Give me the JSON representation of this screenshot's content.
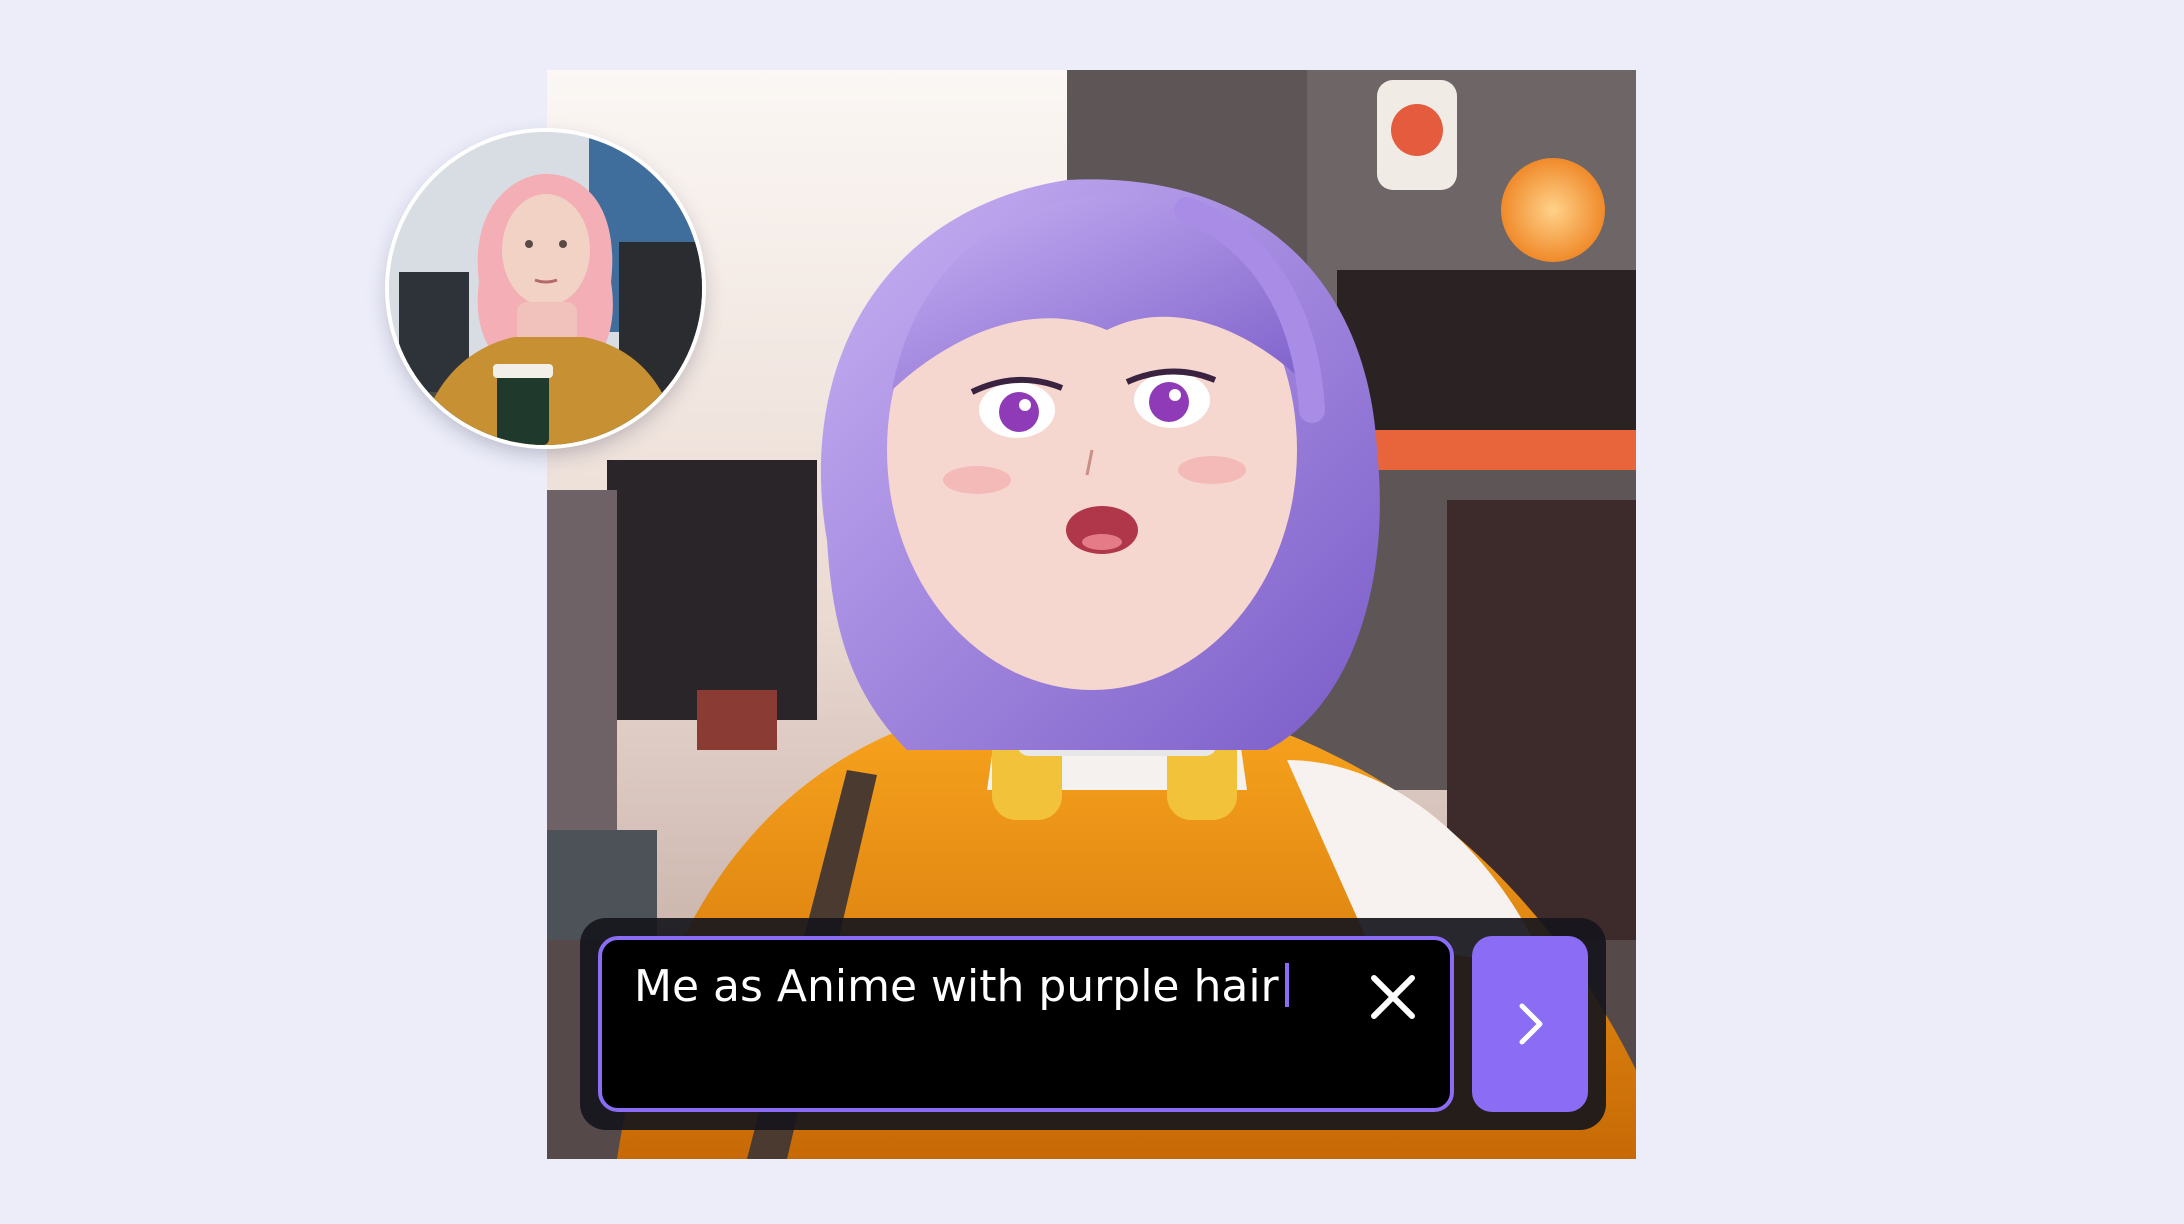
{
  "prompt": {
    "value": "Me as Anime with purple hair"
  },
  "icons": {
    "clear": "close-icon",
    "submit": "chevron-right-icon"
  },
  "colors": {
    "page_background": "#ecedf9",
    "accent": "#8b6cf5",
    "prompt_field_background": "#000000",
    "prompt_bar_background": "#16161c",
    "prompt_text": "#ffffff"
  }
}
